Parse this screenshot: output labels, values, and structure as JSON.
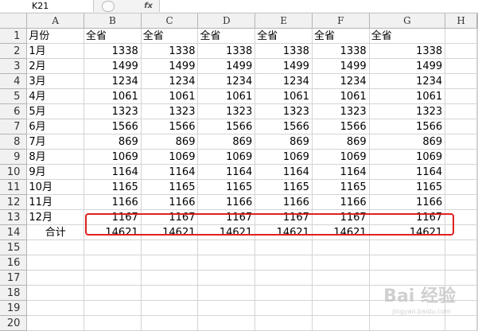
{
  "formula_bar": {
    "name_box": "K21",
    "fx_label": "fx",
    "formula": ""
  },
  "columns": [
    "A",
    "B",
    "C",
    "D",
    "E",
    "F",
    "G",
    "H"
  ],
  "rows": [
    [
      "月份",
      "全省",
      "全省",
      "全省",
      "全省",
      "全省",
      "全省",
      ""
    ],
    [
      "1月",
      "1338",
      "1338",
      "1338",
      "1338",
      "1338",
      "1338",
      ""
    ],
    [
      "2月",
      "1499",
      "1499",
      "1499",
      "1499",
      "1499",
      "1499",
      ""
    ],
    [
      "3月",
      "1234",
      "1234",
      "1234",
      "1234",
      "1234",
      "1234",
      ""
    ],
    [
      "4月",
      "1061",
      "1061",
      "1061",
      "1061",
      "1061",
      "1061",
      ""
    ],
    [
      "5月",
      "1323",
      "1323",
      "1323",
      "1323",
      "1323",
      "1323",
      ""
    ],
    [
      "6月",
      "1566",
      "1566",
      "1566",
      "1566",
      "1566",
      "1566",
      ""
    ],
    [
      "7月",
      "869",
      "869",
      "869",
      "869",
      "869",
      "869",
      ""
    ],
    [
      "8月",
      "1069",
      "1069",
      "1069",
      "1069",
      "1069",
      "1069",
      ""
    ],
    [
      "9月",
      "1164",
      "1164",
      "1164",
      "1164",
      "1164",
      "1164",
      ""
    ],
    [
      "10月",
      "1165",
      "1165",
      "1165",
      "1165",
      "1165",
      "1165",
      ""
    ],
    [
      "11月",
      "1166",
      "1166",
      "1166",
      "1166",
      "1166",
      "1166",
      ""
    ],
    [
      "12月",
      "1167",
      "1167",
      "1167",
      "1167",
      "1167",
      "1167",
      ""
    ],
    [
      "合计",
      "14621",
      "14621",
      "14621",
      "14621",
      "14621",
      "14621",
      ""
    ],
    [
      "",
      "",
      "",
      "",
      "",
      "",
      "",
      ""
    ],
    [
      "",
      "",
      "",
      "",
      "",
      "",
      "",
      ""
    ],
    [
      "",
      "",
      "",
      "",
      "",
      "",
      "",
      ""
    ],
    [
      "",
      "",
      "",
      "",
      "",
      "",
      "",
      ""
    ],
    [
      "",
      "",
      "",
      "",
      "",
      "",
      "",
      ""
    ],
    [
      "",
      "",
      "",
      "",
      "",
      "",
      "",
      ""
    ]
  ],
  "watermark": {
    "text": "Bai 经验",
    "sub": "jingyan.baidu.com"
  },
  "colors": {
    "highlight": "#e02020",
    "header_bg": "#f1f1f1",
    "gridline": "#d4d4d4"
  }
}
